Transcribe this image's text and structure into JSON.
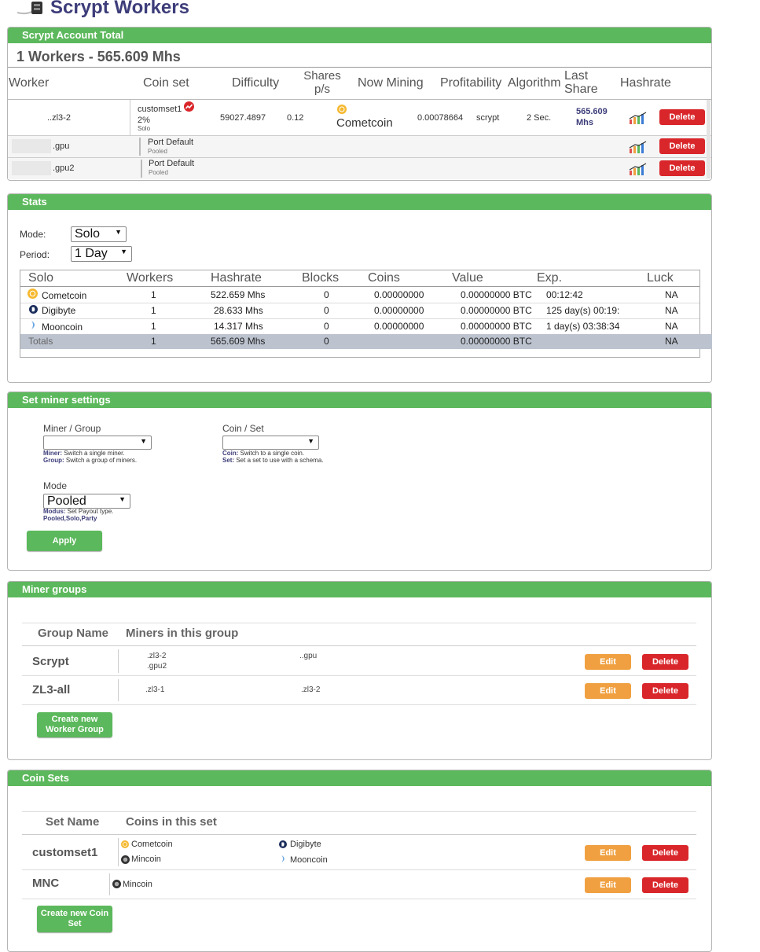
{
  "page": {
    "title": "Scrypt Workers"
  },
  "account": {
    "header": "Scrypt Account Total",
    "summary": "1 Workers - 565.609 Mhs",
    "columns": [
      "Worker",
      "Coin set",
      "Difficulty",
      "Shares p/s",
      "Now Mining",
      "Profitability",
      "Algorithm",
      "Last Share",
      "Hashrate"
    ],
    "workers": [
      {
        "name": "..zl3-2",
        "coinset": "customset1",
        "coinset_pct": "2%",
        "coinset_mode": "Solo",
        "difficulty": "59027.4897",
        "shares": "0.12",
        "mining": "Cometcoin",
        "profit": "0.00078664",
        "algo": "scrypt",
        "last": "2 Sec.",
        "hashrate": "565.609",
        "hashrate_unit": "Mhs",
        "delete": "Delete"
      },
      {
        "name": ".gpu",
        "port": "Port Default",
        "port_sub": "Pooled",
        "delete": "Delete"
      },
      {
        "name": ".gpu2",
        "port": "Port Default",
        "port_sub": "Pooled",
        "delete": "Delete"
      }
    ]
  },
  "stats": {
    "header": "Stats",
    "mode_label": "Mode:",
    "mode_value": "Solo",
    "period_label": "Period:",
    "period_value": "1 Day",
    "columns": [
      "Solo",
      "Workers",
      "Hashrate",
      "Blocks",
      "Coins",
      "Value",
      "Exp.",
      "Luck"
    ],
    "rows": [
      {
        "coin": "Cometcoin",
        "icon": "cometcoin-icon",
        "workers": "1",
        "hashrate": "522.659 Mhs",
        "blocks": "0",
        "coins": "0.00000000",
        "value": "0.00000000 BTC",
        "exp": "00:12:42",
        "luck": "NA"
      },
      {
        "coin": "Digibyte",
        "icon": "digibyte-icon",
        "workers": "1",
        "hashrate": "28.633 Mhs",
        "blocks": "0",
        "coins": "0.00000000",
        "value": "0.00000000 BTC",
        "exp": "125 day(s) 00:19:",
        "luck": "NA"
      },
      {
        "coin": "Mooncoin",
        "icon": "mooncoin-icon",
        "workers": "1",
        "hashrate": "14.317 Mhs",
        "blocks": "0",
        "coins": "0.00000000",
        "value": "0.00000000 BTC",
        "exp": "1 day(s) 03:38:34",
        "luck": "NA"
      }
    ],
    "totals": {
      "label": "Totals",
      "workers": "1",
      "hashrate": "565.609 Mhs",
      "blocks": "0",
      "value": "0.00000000 BTC",
      "luck": "NA"
    }
  },
  "miner_settings": {
    "header": "Set miner settings",
    "miner_label": "Miner / Group",
    "miner_hint1_key": "Miner:",
    "miner_hint1": " Switch a single miner.",
    "miner_hint2_key": "Group:",
    "miner_hint2": " Switch a group of miners.",
    "coin_label": "Coin / Set",
    "coin_hint1_key": "Coin:",
    "coin_hint1": " Switch to a single coin.",
    "coin_hint2_key": "Set:",
    "coin_hint2": " Set a set to use with a schema.",
    "mode_label": "Mode",
    "mode_value": "Pooled",
    "mode_hint1_key": "Modus:",
    "mode_hint1": " Set Payout type.",
    "mode_hint2": "Pooled,Solo,Party",
    "apply": "Apply"
  },
  "groups": {
    "header": "Miner groups",
    "col_name": "Group Name",
    "col_miners": "Miners in this group",
    "rows": [
      {
        "name": "Scrypt",
        "m1": ".zl3-2",
        "m2": ".gpu2",
        "m3": "..gpu",
        "edit": "Edit",
        "delete": "Delete"
      },
      {
        "name": "ZL3-all",
        "m1": ".zl3-1",
        "m3": ".zl3-2",
        "edit": "Edit",
        "delete": "Delete"
      }
    ],
    "create": "Create new Worker Group"
  },
  "coinsets": {
    "header": "Coin Sets",
    "col_name": "Set Name",
    "col_coins": "Coins in this set",
    "rows": [
      {
        "name": "customset1",
        "c1": "Cometcoin",
        "c2": "Mincoin",
        "c3": "Digibyte",
        "c4": "Mooncoin",
        "edit": "Edit",
        "delete": "Delete"
      },
      {
        "name": "MNC",
        "c1": "Mincoin",
        "edit": "Edit",
        "delete": "Delete"
      }
    ],
    "create": "Create new Coin Set"
  },
  "colors": {
    "green": "#5cb85c",
    "red": "#d9262a",
    "orange": "#f0a040",
    "navy": "#3d3d7a"
  }
}
